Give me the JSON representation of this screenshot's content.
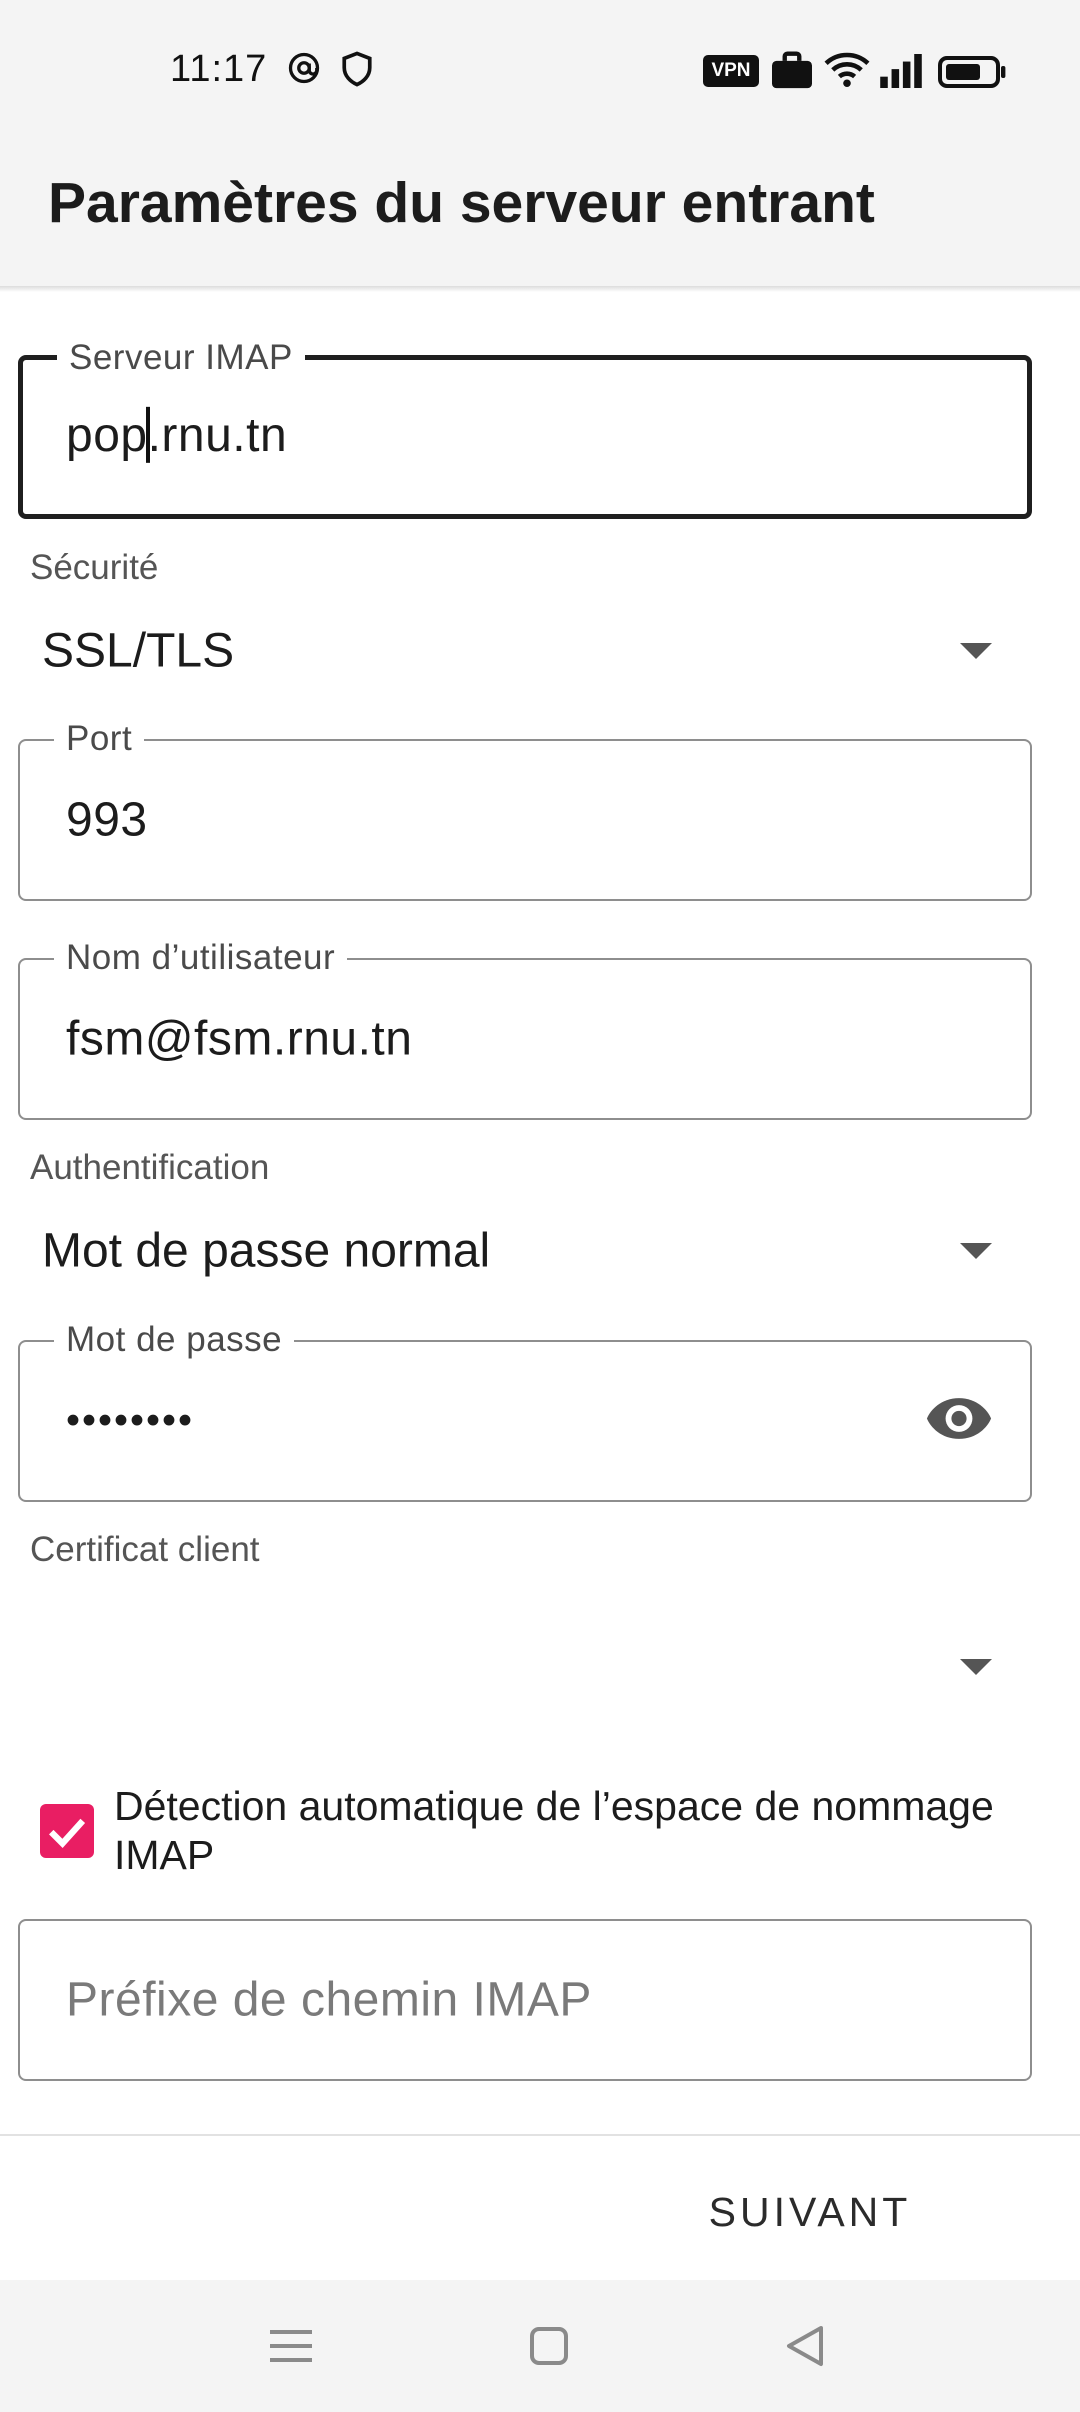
{
  "status_bar": {
    "time": "11:17",
    "left_icons": [
      "at-sign-icon",
      "shield-icon"
    ],
    "right_icons": [
      "vpn-icon",
      "briefcase-icon",
      "wifi-icon",
      "signal-icon",
      "battery-icon"
    ],
    "vpn_label": "VPN"
  },
  "app_bar": {
    "title": "Paramètres du serveur entrant"
  },
  "form": {
    "imap_server": {
      "label": "Serveur IMAP",
      "value_before_cursor": "pop",
      "value_after_cursor": ".rnu.tn"
    },
    "security": {
      "label": "Sécurité",
      "value": "SSL/TLS"
    },
    "port": {
      "label": "Port",
      "value": "993"
    },
    "username": {
      "label": "Nom d’utilisateur",
      "value": "fsm@fsm.rnu.tn"
    },
    "authentication": {
      "label": "Authentification",
      "value": "Mot de passe normal"
    },
    "password": {
      "label": "Mot de passe",
      "value": "••••••••",
      "toggle_icon": "eye-icon"
    },
    "client_certificate": {
      "label": "Certificat client",
      "value": ""
    },
    "auto_namespace": {
      "label": "Détection automatique de l’espace de nommage IMAP",
      "checked": true
    },
    "imap_path_prefix": {
      "placeholder": "Préfixe de chemin IMAP",
      "value": ""
    }
  },
  "actions": {
    "next_label": "SUIVANT"
  },
  "nav_bar": {
    "icons": [
      "menu-icon",
      "home-square-icon",
      "back-triangle-icon"
    ]
  },
  "colors": {
    "accent": "#e91e63",
    "bar_background": "#f4f4f4"
  }
}
